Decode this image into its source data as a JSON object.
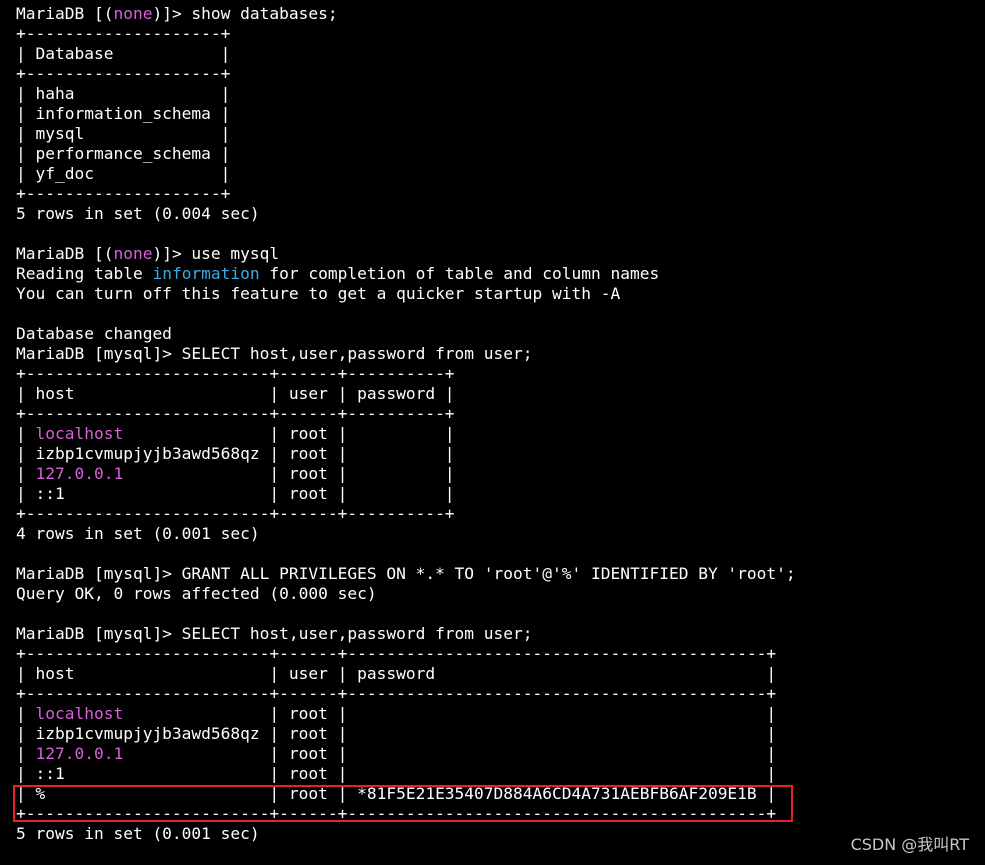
{
  "terminal": {
    "lines": [
      [
        {
          "t": "MariaDB [("
        },
        {
          "t": "none",
          "c": "m"
        },
        {
          "t": ")]> show databases;"
        }
      ],
      [
        {
          "t": "+--------------------+"
        }
      ],
      [
        {
          "t": "| Database           |"
        }
      ],
      [
        {
          "t": "+--------------------+"
        }
      ],
      [
        {
          "t": "| haha               |"
        }
      ],
      [
        {
          "t": "| information_schema |"
        }
      ],
      [
        {
          "t": "| mysql              |"
        }
      ],
      [
        {
          "t": "| performance_schema |"
        }
      ],
      [
        {
          "t": "| yf_doc             |"
        }
      ],
      [
        {
          "t": "+--------------------+"
        }
      ],
      [
        {
          "t": "5 rows in set (0.004 sec)"
        }
      ],
      [
        {
          "t": ""
        }
      ],
      [
        {
          "t": "MariaDB [("
        },
        {
          "t": "none",
          "c": "m"
        },
        {
          "t": ")]> use mysql"
        }
      ],
      [
        {
          "t": "Reading table "
        },
        {
          "t": "information",
          "c": "c"
        },
        {
          "t": " for completion of table and column names"
        }
      ],
      [
        {
          "t": "You can turn off this feature to get a quicker startup with -A"
        }
      ],
      [
        {
          "t": ""
        }
      ],
      [
        {
          "t": "Database changed"
        }
      ],
      [
        {
          "t": "MariaDB [mysql]> SELECT host,user,password from user;"
        }
      ],
      [
        {
          "t": "+-------------------------+------+----------+"
        }
      ],
      [
        {
          "t": "| host                    | user | password |"
        }
      ],
      [
        {
          "t": "+-------------------------+------+----------+"
        }
      ],
      [
        {
          "t": "| "
        },
        {
          "t": "localhost",
          "c": "m"
        },
        {
          "t": "               | root |          |"
        }
      ],
      [
        {
          "t": "| izbp1cvmupjyjb3awd568qz | root |          |"
        }
      ],
      [
        {
          "t": "| "
        },
        {
          "t": "127.0.0.1",
          "c": "m"
        },
        {
          "t": "               | root |          |"
        }
      ],
      [
        {
          "t": "| ::1                     | root |          |"
        }
      ],
      [
        {
          "t": "+-------------------------+------+----------+"
        }
      ],
      [
        {
          "t": "4 rows in set (0.001 sec)"
        }
      ],
      [
        {
          "t": ""
        }
      ],
      [
        {
          "t": "MariaDB [mysql]> GRANT ALL PRIVILEGES ON *.* TO 'root'@'%' IDENTIFIED BY 'root';"
        }
      ],
      [
        {
          "t": "Query OK, 0 rows affected (0.000 sec)"
        }
      ],
      [
        {
          "t": ""
        }
      ],
      [
        {
          "t": "MariaDB [mysql]> SELECT host,user,password from user;"
        }
      ],
      [
        {
          "t": "+-------------------------+------+-------------------------------------------+"
        }
      ],
      [
        {
          "t": "| host                    | user | password                                  |"
        }
      ],
      [
        {
          "t": "+-------------------------+------+-------------------------------------------+"
        }
      ],
      [
        {
          "t": "| "
        },
        {
          "t": "localhost",
          "c": "m"
        },
        {
          "t": "               | root |                                           |"
        }
      ],
      [
        {
          "t": "| izbp1cvmupjyjb3awd568qz | root |                                           |"
        }
      ],
      [
        {
          "t": "| "
        },
        {
          "t": "127.0.0.1",
          "c": "m"
        },
        {
          "t": "               | root |                                           |"
        }
      ],
      [
        {
          "t": "| ::1                     | root |                                           |"
        }
      ],
      [
        {
          "t": "| %                       | root | *81F5E21E35407D884A6CD4A731AEBFB6AF209E1B |"
        }
      ],
      [
        {
          "t": "+-------------------------+------+-------------------------------------------+"
        }
      ],
      [
        {
          "t": "5 rows in set (0.001 sec)"
        }
      ]
    ]
  },
  "watermark": "CSDN @我叫RT",
  "colors": {
    "background": "#000000",
    "text": "#ffffff",
    "magenta": "#d75fd7",
    "cyan": "#3fa9e6",
    "highlight_box": "#e8202a"
  }
}
